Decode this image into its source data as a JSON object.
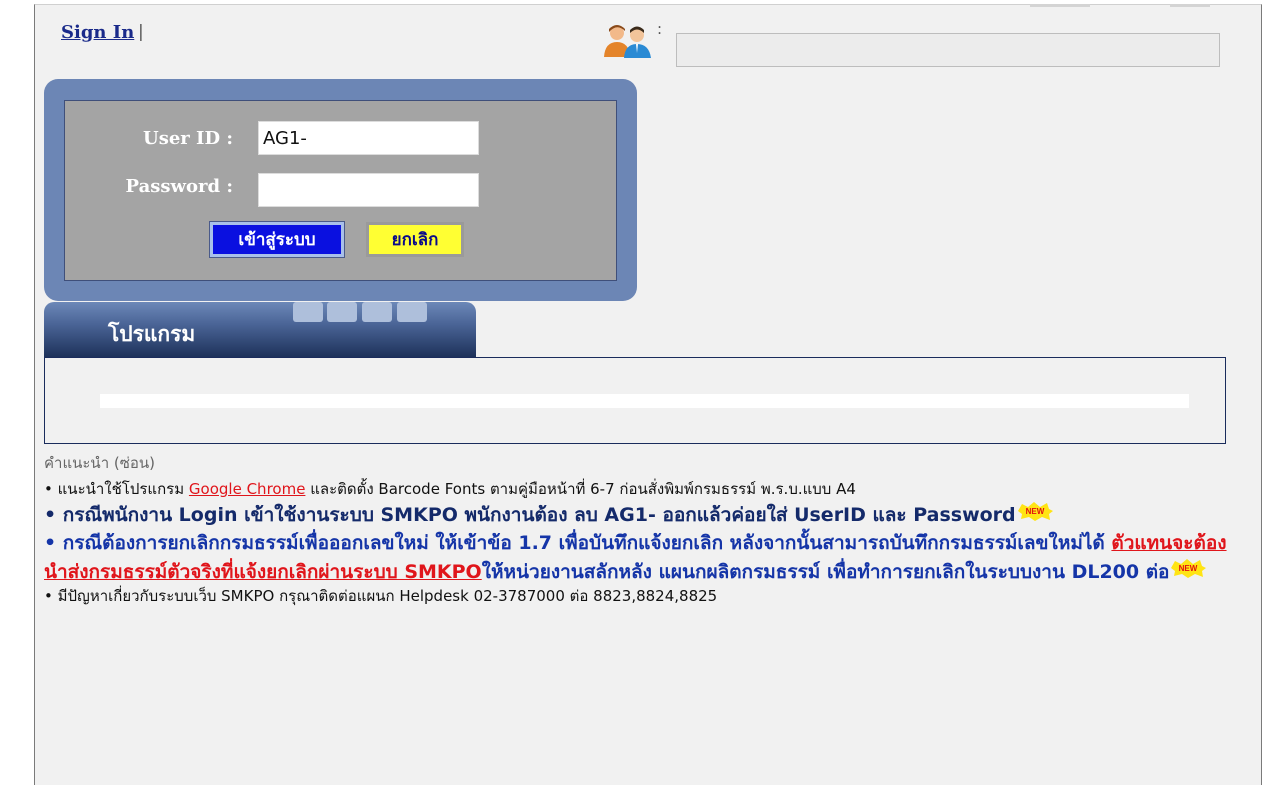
{
  "header": {
    "signin_label": "Sign In",
    "separator": "|",
    "user_icon": "users-icon",
    "user_colon": ":",
    "user_field_value": ""
  },
  "login": {
    "userid_label": "User ID :",
    "userid_value": "AG1-",
    "password_label": "Password :",
    "password_value": "",
    "login_button": "เข้าสู่ระบบ",
    "cancel_button": "ยกเลิก"
  },
  "program": {
    "tab_label": "โปรแกรม"
  },
  "notes": {
    "title": "คำแนะนำ (ซ่อน)",
    "bullet": "•",
    "badge": "NEW",
    "note1": {
      "pre": "แนะนำใช้โปรแกรม",
      "link": "Google Chrome",
      "post": "และติดตั้ง Barcode Fonts ตามคู่มือหน้าที่ 6-7 ก่อนสั่งพิมพ์กรมธรรม์ พ.ร.บ.แบบ A4"
    },
    "note2": {
      "text": "กรณีพนักงาน Login เข้าใช้งานระบบ SMKPO พนักงานต้อง ลบ AG1- ออกแล้วค่อยใส่ UserID และ Password"
    },
    "note3": {
      "pre": "กรณีต้องการยกเลิกกรมธรรม์เพื่อออกเลขใหม่ ให้เข้าข้อ 1.7 เพื่อบันทึกแจ้งยกเลิก หลังจากนั้นสามารถบันทึกกรมธรรม์เลขใหม่ได้",
      "link": "ตัวแทนจะต้องนำส่งกรมธรรม์ตัวจริงที่แจ้งยกเลิกผ่านระบบ SMKPO",
      "post": "ให้หน่วยงานสลักหลัง แผนกผลิตกรมธรรม์ เพื่อทำการยกเลิกในระบบงาน DL200 ต่อ"
    },
    "note4": {
      "text": "มีปัญหาเกี่ยวกับระบบเว็บ SMKPO กรุณาติดต่อแผนก Helpdesk 02-3787000 ต่อ 8823,8824,8825"
    }
  },
  "colors": {
    "navy_text": "#142a6a",
    "blue_text": "#1535a8",
    "link_red": "#e0151b",
    "login_button_bg": "#0a10e0",
    "cancel_button_bg": "#ffff33",
    "login_box_bg": "#6c86b5"
  }
}
